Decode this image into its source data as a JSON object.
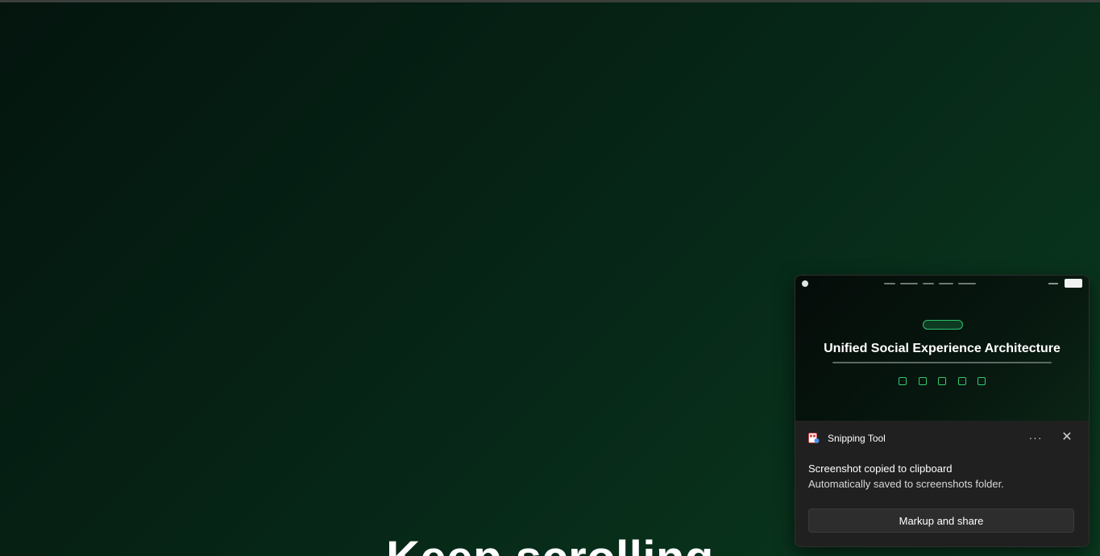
{
  "background": {
    "heading": "Keep scrolling",
    "colors": {
      "dark": "#04150e",
      "mid": "#062416",
      "light": "#0a3a1f"
    }
  },
  "toast": {
    "app_name": "Snipping Tool",
    "app_icon": "snipping-tool-icon",
    "more_icon": "more-options-icon",
    "close_icon": "close-icon",
    "more_label": "···",
    "close_label": "✕",
    "message_title": "Screenshot copied to clipboard",
    "message_body": "Automatically saved to screenshots folder.",
    "action_label": "Markup and share",
    "preview": {
      "title": "Unified Social Experience Architecture",
      "accent": "#35c873",
      "social_icons": [
        "nostr-icon",
        "bluesky-icon",
        "x-icon",
        "tiktok-icon",
        "threads-icon"
      ]
    }
  }
}
